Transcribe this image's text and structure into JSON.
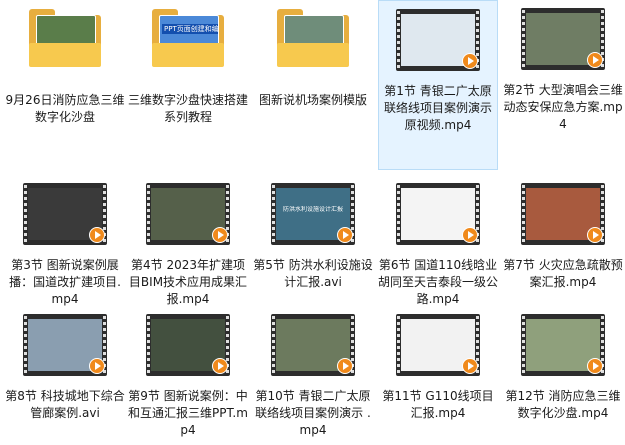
{
  "items": [
    {
      "kind": "folder",
      "label": "9月26日消防应急三维数字化沙盘",
      "caption": "",
      "paper": "#5a7d4a"
    },
    {
      "kind": "folder",
      "label": "三维数字沙盘快速搭建系列教程",
      "caption": "PPT页面创建和编辑技巧",
      "paper": "#4b89d8"
    },
    {
      "kind": "folder",
      "label": "图新说机场案例模版",
      "caption": "",
      "paper": "#6f8d7a"
    },
    {
      "kind": "video",
      "label": "第1节 青银二广太原联络线项目案例演示 原视频.mp4",
      "selected": true,
      "frame": "#dfe8ef",
      "frameText": "",
      "textColor": "#333333"
    },
    {
      "kind": "video",
      "label": "第2节 大型演唱会三维动态安保应急方案.mp4",
      "frame": "#6f7d64",
      "frameText": "",
      "textColor": "#ffffff"
    },
    {
      "kind": "video",
      "label": "第3节 图新说案例展播：国道改扩建项目.mp4",
      "frame": "#3a3a3a",
      "frameText": "",
      "textColor": "#ffffff"
    },
    {
      "kind": "video",
      "label": "第4节 2023年扩建项目BIM技术应用成果汇报.mp4",
      "frame": "#55604a",
      "frameText": "",
      "textColor": "#ffffff"
    },
    {
      "kind": "video",
      "label": "第5节 防洪水利设施设计汇报.avi",
      "frame": "#3f6f86",
      "frameText": "防洪水利设施设计汇报",
      "textColor": "#ffffff"
    },
    {
      "kind": "video",
      "label": "第6节 国道110线晗业胡同至天吉泰段一级公路.mp4",
      "frame": "#f4f4f4",
      "frameText": "",
      "textColor": "#333333"
    },
    {
      "kind": "video",
      "label": "第7节 火灾应急疏散预案汇报.mp4",
      "frame": "#a85a3e",
      "frameText": "",
      "textColor": "#ffffff"
    },
    {
      "kind": "video",
      "label": "第8节 科技城地下综合管廊案例.avi",
      "frame": "#8a9eb0",
      "frameText": "",
      "textColor": "#ffffff"
    },
    {
      "kind": "video",
      "label": "第9节 图新说案例：中和互通汇报三维PPT.mp4",
      "frame": "#43503f",
      "frameText": "",
      "textColor": "#ffffff"
    },
    {
      "kind": "video",
      "label": "第10节 青银二广太原联络线项目案例演示 .mp4",
      "frame": "#6c7a5e",
      "frameText": "",
      "textColor": "#ffffff"
    },
    {
      "kind": "video",
      "label": "第11节 G110线项目汇报.mp4",
      "frame": "#f2f2f2",
      "frameText": "",
      "textColor": "#333333"
    },
    {
      "kind": "video",
      "label": "第12节  消防应急三维数字化沙盘.mp4",
      "frame": "#8fa07c",
      "frameText": "",
      "textColor": "#ffffff"
    }
  ]
}
